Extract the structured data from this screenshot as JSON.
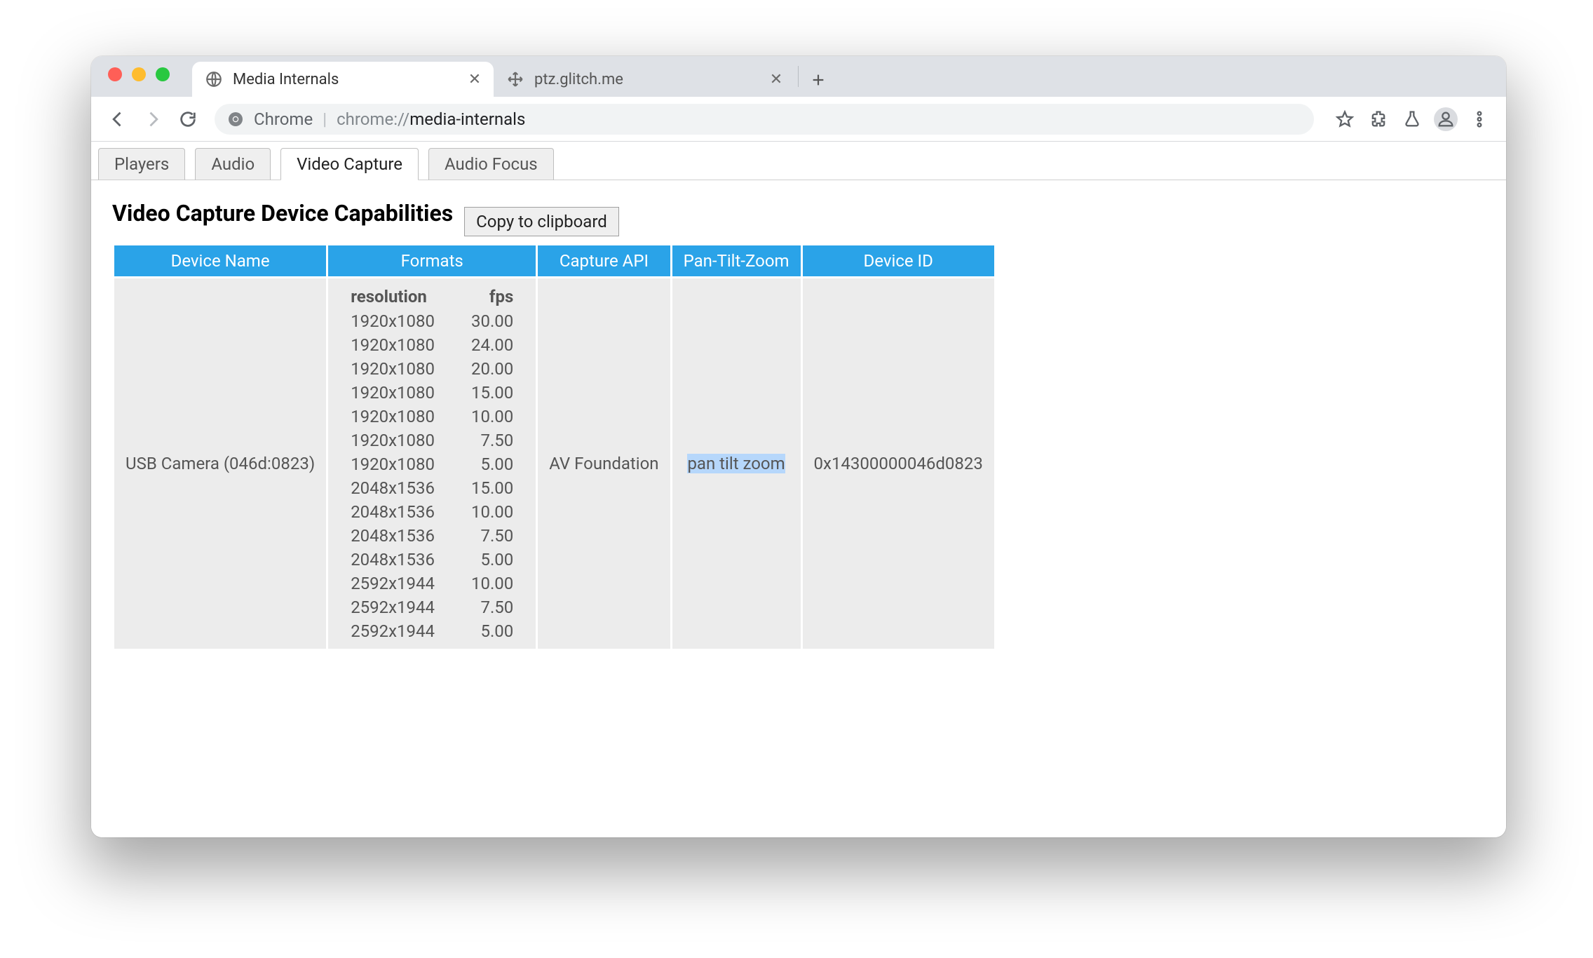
{
  "browser": {
    "tabs": [
      {
        "title": "Media Internals",
        "active": true,
        "favicon": "globe"
      },
      {
        "title": "ptz.glitch.me",
        "active": false,
        "favicon": "move"
      }
    ],
    "nav": {
      "back_enabled": true,
      "forward_enabled": false
    },
    "omnibox": {
      "chip": "Chrome",
      "url_dim": "chrome://",
      "url_rest": "media-internals"
    }
  },
  "page": {
    "tabs": [
      {
        "label": "Players",
        "active": false
      },
      {
        "label": "Audio",
        "active": false
      },
      {
        "label": "Video Capture",
        "active": true
      },
      {
        "label": "Audio Focus",
        "active": false
      }
    ],
    "section_title": "Video Capture Device Capabilities",
    "copy_button": "Copy to clipboard",
    "table": {
      "headers": [
        "Device Name",
        "Formats",
        "Capture API",
        "Pan-Tilt-Zoom",
        "Device ID"
      ],
      "formats_sub": {
        "resolution": "resolution",
        "fps": "fps"
      },
      "rows": [
        {
          "device_name": "USB Camera (046d:0823)",
          "capture_api": "AV Foundation",
          "ptz": "pan tilt zoom",
          "ptz_highlighted": true,
          "device_id": "0x14300000046d0823",
          "formats": [
            {
              "resolution": "1920x1080",
              "fps": "30.00"
            },
            {
              "resolution": "1920x1080",
              "fps": "24.00"
            },
            {
              "resolution": "1920x1080",
              "fps": "20.00"
            },
            {
              "resolution": "1920x1080",
              "fps": "15.00"
            },
            {
              "resolution": "1920x1080",
              "fps": "10.00"
            },
            {
              "resolution": "1920x1080",
              "fps": "7.50"
            },
            {
              "resolution": "1920x1080",
              "fps": "5.00"
            },
            {
              "resolution": "2048x1536",
              "fps": "15.00"
            },
            {
              "resolution": "2048x1536",
              "fps": "10.00"
            },
            {
              "resolution": "2048x1536",
              "fps": "7.50"
            },
            {
              "resolution": "2048x1536",
              "fps": "5.00"
            },
            {
              "resolution": "2592x1944",
              "fps": "10.00"
            },
            {
              "resolution": "2592x1944",
              "fps": "7.50"
            },
            {
              "resolution": "2592x1944",
              "fps": "5.00"
            }
          ]
        }
      ]
    }
  }
}
